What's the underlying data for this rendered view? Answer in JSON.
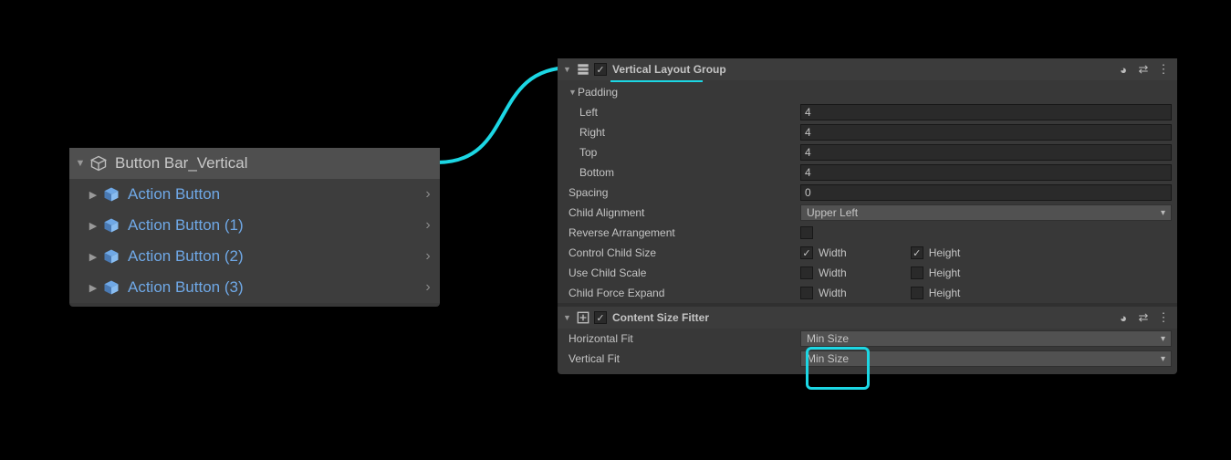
{
  "hierarchy": {
    "parent": "Button Bar_Vertical",
    "children": [
      "Action Button",
      "Action Button (1)",
      "Action Button (2)",
      "Action Button (3)"
    ]
  },
  "vlg": {
    "title": "Vertical Layout Group",
    "padding_label": "Padding",
    "left_label": "Left",
    "right_label": "Right",
    "top_label": "Top",
    "bottom_label": "Bottom",
    "left": "4",
    "right": "4",
    "top": "4",
    "bottom": "4",
    "spacing_label": "Spacing",
    "spacing": "0",
    "child_alignment_label": "Child Alignment",
    "child_alignment": "Upper Left",
    "reverse_label": "Reverse Arrangement",
    "control_label": "Control Child Size",
    "use_scale_label": "Use Child Scale",
    "force_expand_label": "Child Force Expand",
    "width_label": "Width",
    "height_label": "Height"
  },
  "csf": {
    "title": "Content Size Fitter",
    "hfit_label": "Horizontal Fit",
    "vfit_label": "Vertical Fit",
    "hfit": "Min Size",
    "vfit": "Min Size"
  }
}
